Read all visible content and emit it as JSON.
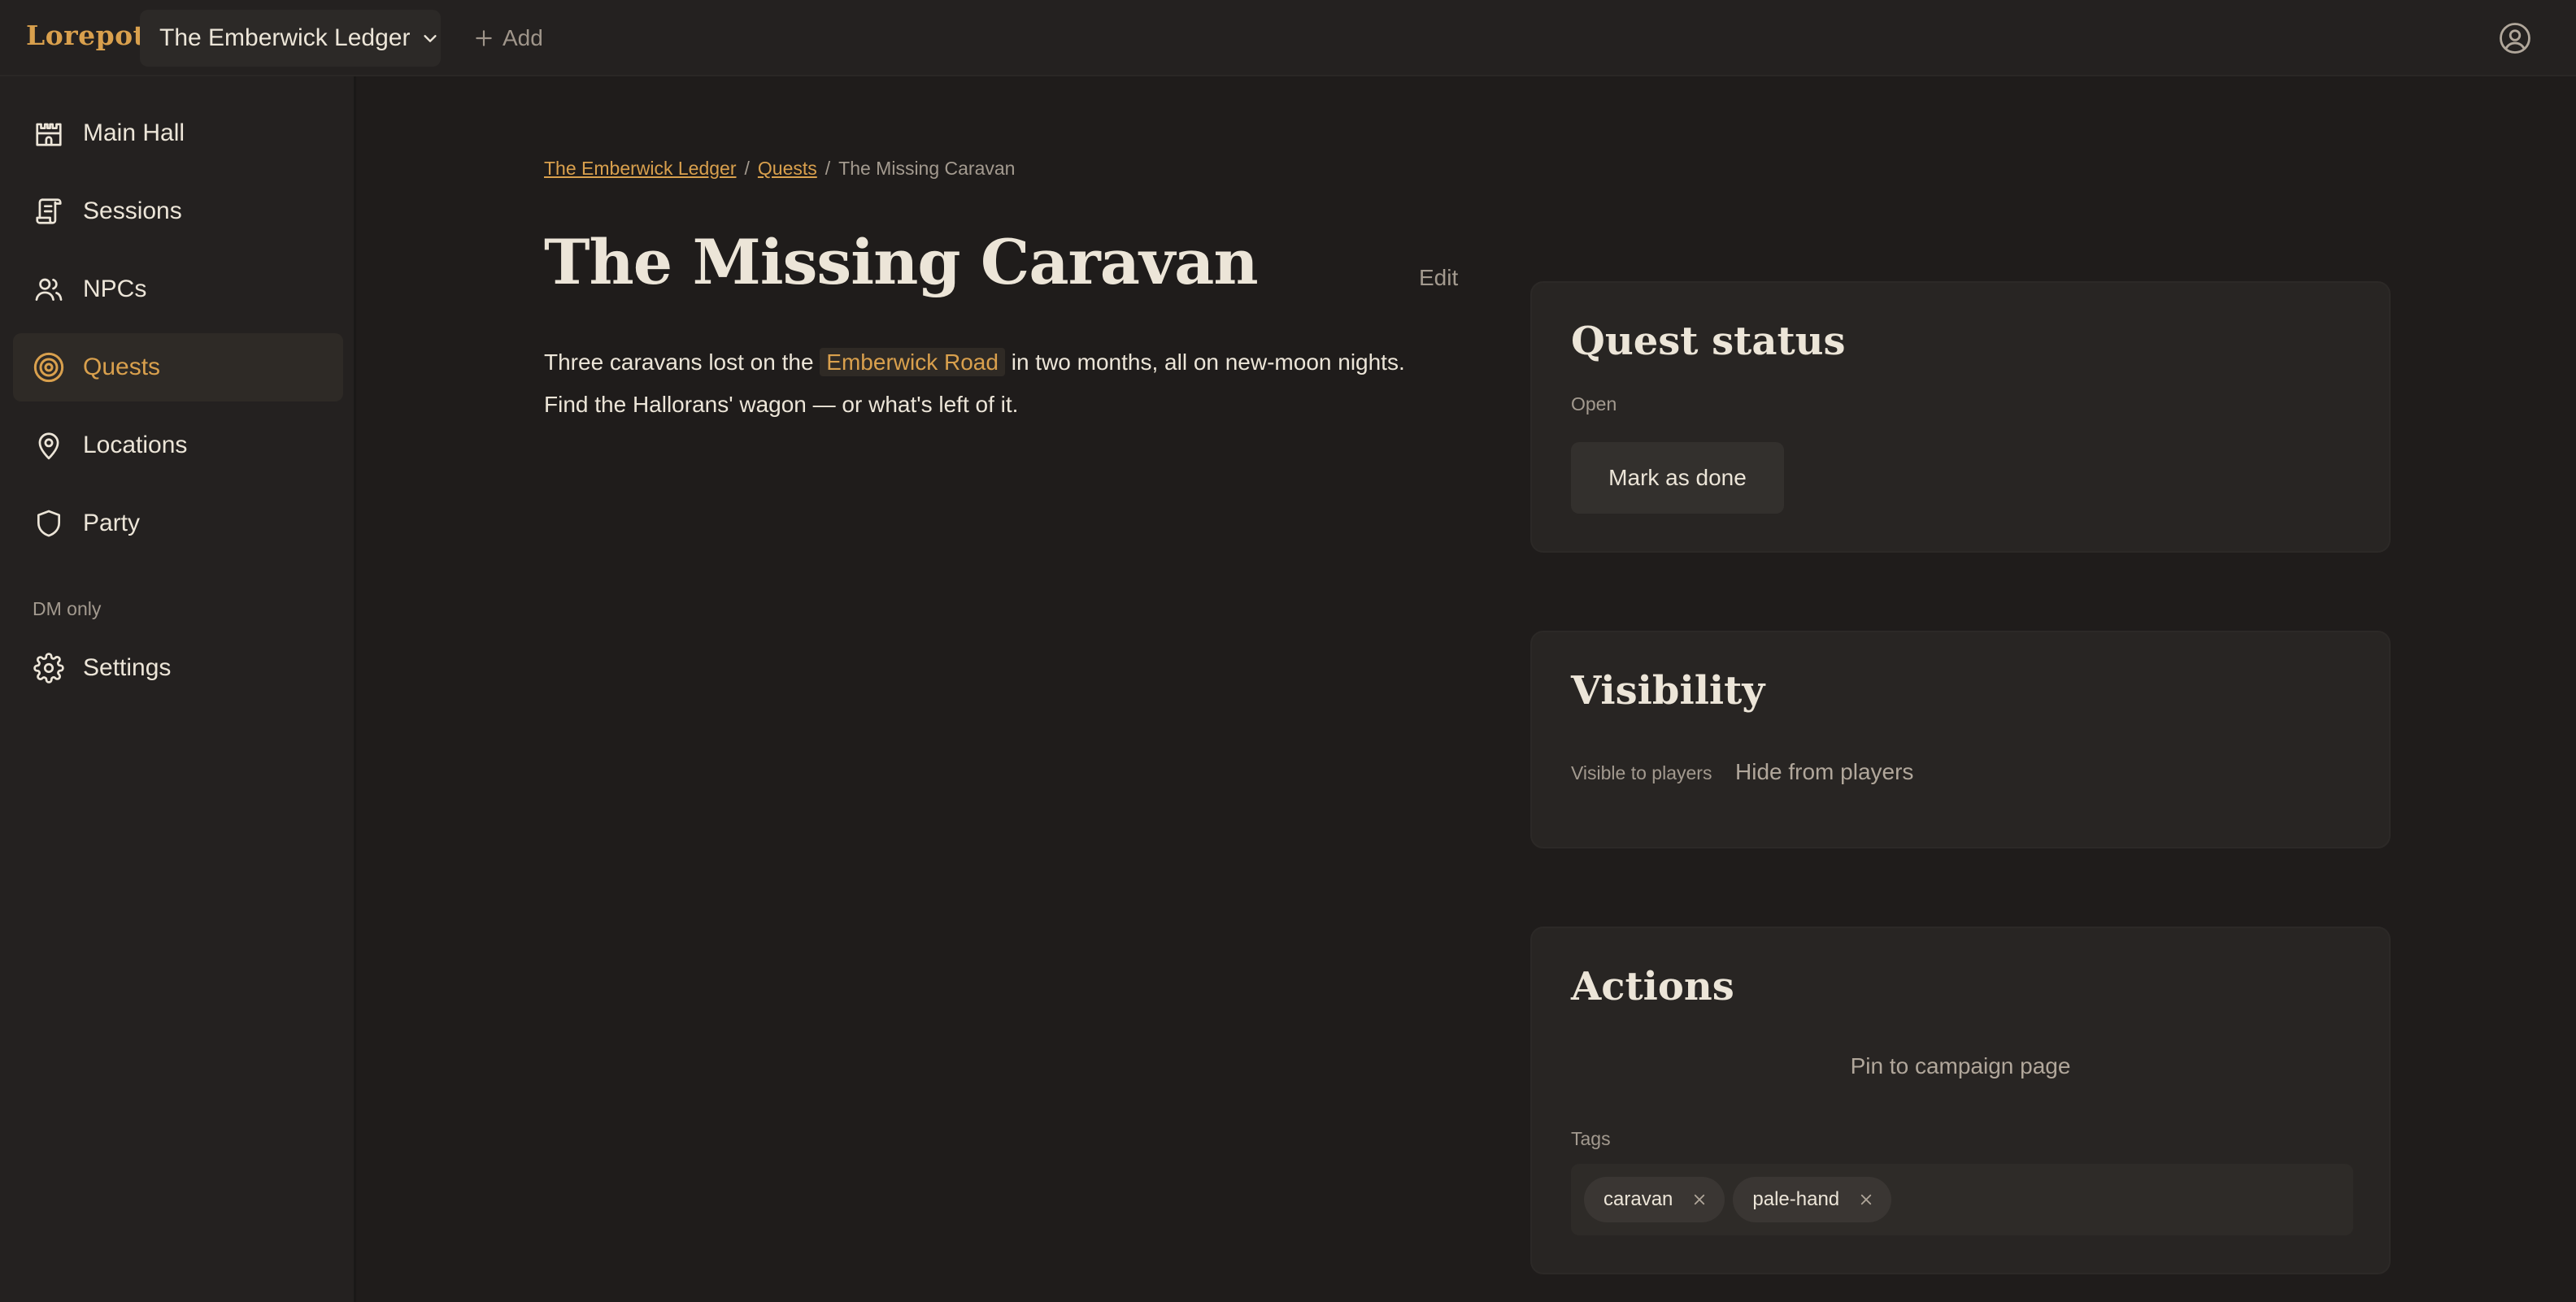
{
  "app": {
    "name": "Lorepot"
  },
  "topbar": {
    "campaign": "The Emberwick Ledger",
    "add_label": "Add"
  },
  "sidebar": {
    "items": [
      {
        "label": "Main Hall",
        "icon": "castle-icon"
      },
      {
        "label": "Sessions",
        "icon": "scroll-icon"
      },
      {
        "label": "NPCs",
        "icon": "users-icon"
      },
      {
        "label": "Quests",
        "icon": "target-icon",
        "active": true
      },
      {
        "label": "Locations",
        "icon": "map-pin-icon"
      },
      {
        "label": "Party",
        "icon": "shield-icon"
      }
    ],
    "section_label": "DM only",
    "settings_label": "Settings"
  },
  "breadcrumb": {
    "items": [
      "The Emberwick Ledger",
      "Quests",
      "The Missing Caravan"
    ],
    "separator": "/"
  },
  "page": {
    "title": "The Missing Caravan",
    "edit_label": "Edit",
    "description_before": "Three caravans lost on the",
    "description_link": "Emberwick Road",
    "description_after": "in two months, all on new-moon nights. Find the Hallorans' wagon — or what's left of it."
  },
  "quest_status": {
    "title": "Quest status",
    "status": "Open",
    "action_label": "Mark as done"
  },
  "visibility": {
    "title": "Visibility",
    "status": "Visible to players",
    "action_label": "Hide from players"
  },
  "actions": {
    "title": "Actions",
    "pin_label": "Pin to campaign page",
    "tags_label": "Tags",
    "tags": [
      "caravan",
      "pale-hand"
    ]
  },
  "colors": {
    "accent": "#d9a04d",
    "background": "#1f1c1b",
    "panel": "#242120",
    "card": "#282523",
    "text": "#ece5d8",
    "muted": "#a39a8f"
  }
}
